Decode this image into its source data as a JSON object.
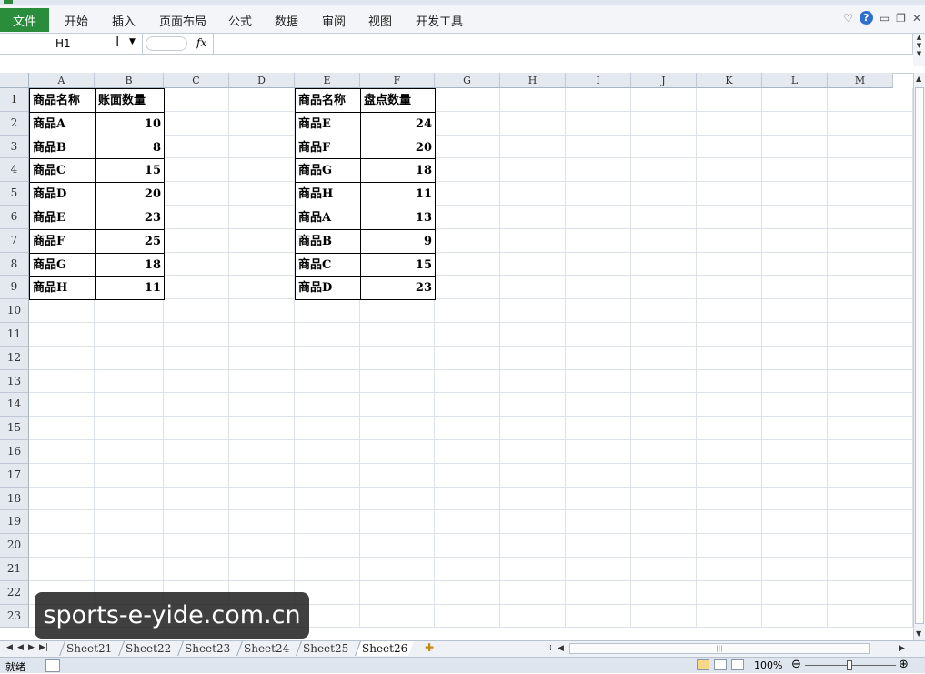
{
  "ribbon": {
    "file": "文件",
    "tabs": [
      "开始",
      "插入",
      "页面布局",
      "公式",
      "数据",
      "审阅",
      "视图",
      "开发工具"
    ]
  },
  "formula_bar": {
    "name_box": "H1",
    "fx": "fx",
    "value": ""
  },
  "columns": [
    "A",
    "B",
    "C",
    "D",
    "E",
    "F",
    "G",
    "H",
    "I",
    "J",
    "K",
    "L",
    "M"
  ],
  "rows": [
    "1",
    "2",
    "3",
    "4",
    "5",
    "6",
    "7",
    "8",
    "9",
    "10",
    "11",
    "12",
    "13",
    "14",
    "15",
    "16",
    "17",
    "18",
    "19",
    "20",
    "21",
    "22",
    "23"
  ],
  "table1": {
    "headers": [
      "商品名称",
      "账面数量"
    ],
    "rows": [
      [
        "商品A",
        "10"
      ],
      [
        "商品B",
        "8"
      ],
      [
        "商品C",
        "15"
      ],
      [
        "商品D",
        "20"
      ],
      [
        "商品E",
        "23"
      ],
      [
        "商品F",
        "25"
      ],
      [
        "商品G",
        "18"
      ],
      [
        "商品H",
        "11"
      ]
    ]
  },
  "table2": {
    "headers": [
      "商品名称",
      "盘点数量"
    ],
    "rows": [
      [
        "商品E",
        "24"
      ],
      [
        "商品F",
        "20"
      ],
      [
        "商品G",
        "18"
      ],
      [
        "商品H",
        "11"
      ],
      [
        "商品A",
        "13"
      ],
      [
        "商品B",
        "9"
      ],
      [
        "商品C",
        "15"
      ],
      [
        "商品D",
        "23"
      ]
    ]
  },
  "sheets": [
    "Sheet21",
    "Sheet22",
    "Sheet23",
    "Sheet24",
    "Sheet25",
    "Sheet26"
  ],
  "active_sheet": "Sheet26",
  "status": {
    "ready": "就绪",
    "zoom": "100%"
  },
  "watermark": "sports-e-yide.com.cn",
  "colors": {
    "file_tab": "#2a8d3c",
    "header_bg": "#e4e9f0",
    "grid": "#dde2e8"
  }
}
